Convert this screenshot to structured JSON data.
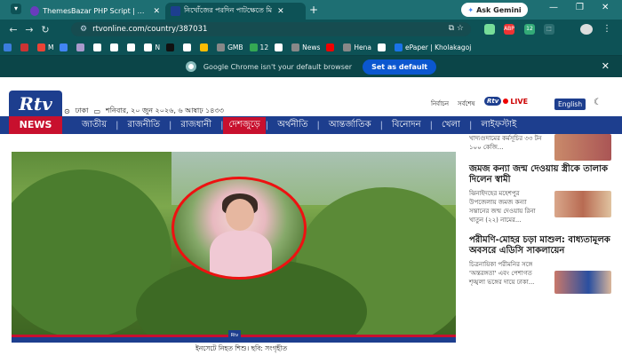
{
  "browser": {
    "tabs": [
      {
        "title": "ThemesBazar PHP Script | Dash"
      },
      {
        "title": "নিখোঁজের পরদিন পাটক্ষেতে মি"
      }
    ],
    "new_tab": "+",
    "ask_gemini": "Ask Gemini",
    "url": "rtvonline.com/country/387031",
    "bookmarks": [
      {
        "label": "",
        "color": "#3b7ddd"
      },
      {
        "label": "",
        "color": "#c33"
      },
      {
        "label": "M",
        "color": "#ea4335"
      },
      {
        "label": "",
        "color": "#4285f4"
      },
      {
        "label": "",
        "color": "#a9c"
      },
      {
        "label": "",
        "color": "#fff"
      },
      {
        "label": "",
        "color": "#fff"
      },
      {
        "label": "",
        "color": "#fff"
      },
      {
        "label": "N",
        "color": "#fff"
      },
      {
        "label": "",
        "color": "#111"
      },
      {
        "label": "",
        "color": "#fff"
      },
      {
        "label": "",
        "color": "#fbbc04"
      },
      {
        "label": "GMB",
        "color": "#888"
      },
      {
        "label": "12",
        "color": "#34a853"
      },
      {
        "label": "",
        "color": "#fff"
      },
      {
        "label": "News",
        "color": "#888"
      },
      {
        "label": "",
        "color": "#e00"
      },
      {
        "label": "Hena",
        "color": "#888"
      },
      {
        "label": "",
        "color": "#fff"
      },
      {
        "label": "ePaper | Kholakagoj",
        "color": "#1a73e8"
      }
    ],
    "infobar": {
      "message": "Google Chrome isn't your default browser",
      "button": "Set as default"
    }
  },
  "site": {
    "logo_text": "Rtv",
    "news_label": "NEWS",
    "location": "ঢাকা",
    "date": "শনিবার, ২০ জুন ২০২৬, ৬ আষাঢ় ১৪৩৩",
    "header_links": [
      "নির্বাচন",
      "সর্বশেষ"
    ],
    "live_label": "LIVE",
    "live_logo": "Rtv",
    "english_button": "English",
    "nav": [
      "জাতীয়",
      "রাজনীতি",
      "রাজধানী",
      "দেশজুড়ে",
      "অর্থনীতি",
      "আন্তর্জাতিক",
      "বিনোদন",
      "খেলা",
      "লাইফস্টাই"
    ],
    "caption": "ইনসেটে নিহত শিশু। ছবি: সংগৃহীত",
    "sidebar": [
      {
        "head": "",
        "snippet": "খাদ্যগুদামের কর্মসূচির ৩৩ টন ১০০ কেজি..."
      },
      {
        "head": "জমজ কন্যা জন্ম দেওয়ায় স্ত্রীকে তালাক দিলেন স্বামী",
        "snippet": "ঝিনাইদহের মহেশপুর উপজেলায় জমজ কন্যা সন্তানের জন্ম দেওয়ায় রিনা খাতুন (২২) নামের..."
      },
      {
        "head": "পরীমণি-মোহর চড়া মাশুল: বাধ্যতামূলক অবসরে এডিসি সাকলায়েন",
        "snippet": "চিত্রনায়িকা পরীমনির সঙ্গে 'অন্তরঙ্গতা' এবং পেশাগত শৃঙ্খলা ভঙ্গের দায়ে ঢাকা..."
      }
    ]
  }
}
